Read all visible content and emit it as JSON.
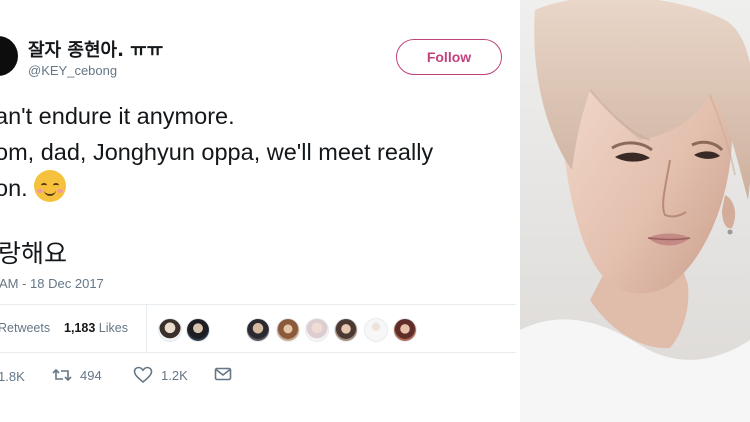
{
  "tweet": {
    "display_name": "잘자 종현아. ㅠㅠ",
    "handle": "@KEY_cebong",
    "follow_label": "Follow",
    "text_lines": [
      "an't endure it anymore.",
      "om, dad, Jonghyun oppa, we'll meet really",
      "on."
    ],
    "emoji_icon": "smiling-face-with-smiling-eyes-icon",
    "text_korean": "랑해요",
    "timestamp": "AM - 18 Dec 2017"
  },
  "stats": {
    "retweets_label": "Retweets",
    "likes_count": "1,183",
    "likes_label": "Likes"
  },
  "actions": {
    "reply_count": "1.8K",
    "retweet_count": "494",
    "like_count": "1.2K",
    "dm_icon": "envelope-icon"
  },
  "colors": {
    "follow_accent": "#c0437e",
    "secondary_text": "#657786",
    "divider": "#e6ecf0"
  }
}
